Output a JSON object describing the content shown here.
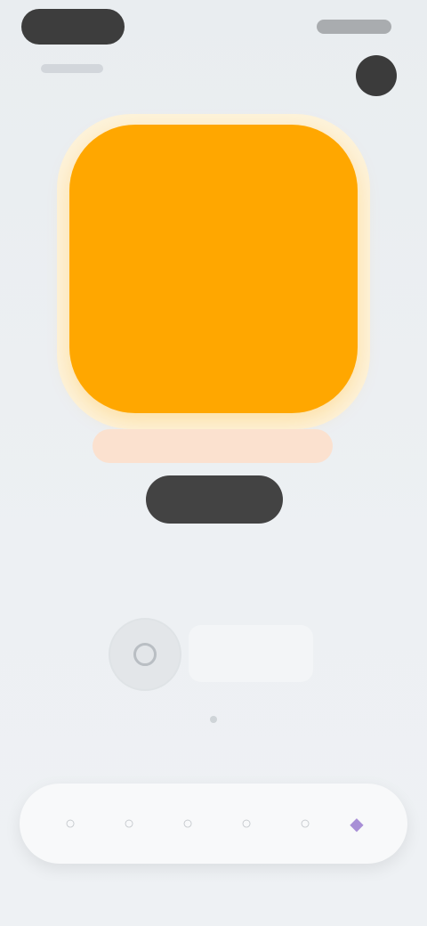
{
  "status_bar": {
    "time": "",
    "indicators": ""
  },
  "header": {
    "back_label": "",
    "title": ""
  },
  "feature": {
    "tile_color": "#ffa700",
    "banner_text": "",
    "button_label": ""
  },
  "controls": {
    "caption": "",
    "options": [
      "",
      ""
    ]
  },
  "tabbar": {
    "tabs": [
      {
        "icon": "home-icon",
        "glyph": "○"
      },
      {
        "icon": "search-icon",
        "glyph": "○"
      },
      {
        "icon": "add-icon",
        "glyph": "○"
      },
      {
        "icon": "library-icon",
        "glyph": "○"
      },
      {
        "icon": "profile-icon",
        "glyph": "○"
      },
      {
        "icon": "settings-icon",
        "glyph": "◆"
      }
    ],
    "active_index": 5,
    "active_color": "#a88fd6"
  }
}
